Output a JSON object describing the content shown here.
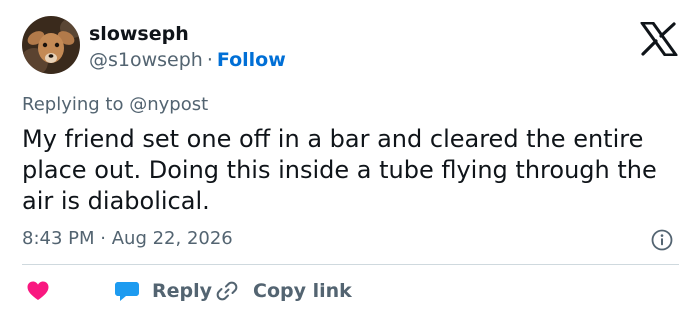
{
  "author": {
    "display_name": "slowseph",
    "handle": "@s1owseph",
    "separator": "·",
    "follow_label": "Follow"
  },
  "replying": {
    "prefix": "Replying to",
    "target": "@nypost"
  },
  "tweet": {
    "text": "My friend set one off in a bar and cleared the entire place out. Doing this inside a tube flying through the air is diabolical.",
    "time": "8:43 PM",
    "separator": "·",
    "date": "Aug 22, 2026"
  },
  "actions": {
    "reply_label": "Reply",
    "copy_link_label": "Copy link"
  },
  "icons": {
    "logo": "x-logo-icon",
    "info": "info-icon",
    "like": "heart-icon",
    "reply": "speech-bubble-icon",
    "copy": "link-icon"
  },
  "colors": {
    "text": "#0f1419",
    "secondary": "#536471",
    "link": "#006fd6",
    "like": "#f91880",
    "reply": "#1d9bf0",
    "divider": "#cfd9de"
  }
}
